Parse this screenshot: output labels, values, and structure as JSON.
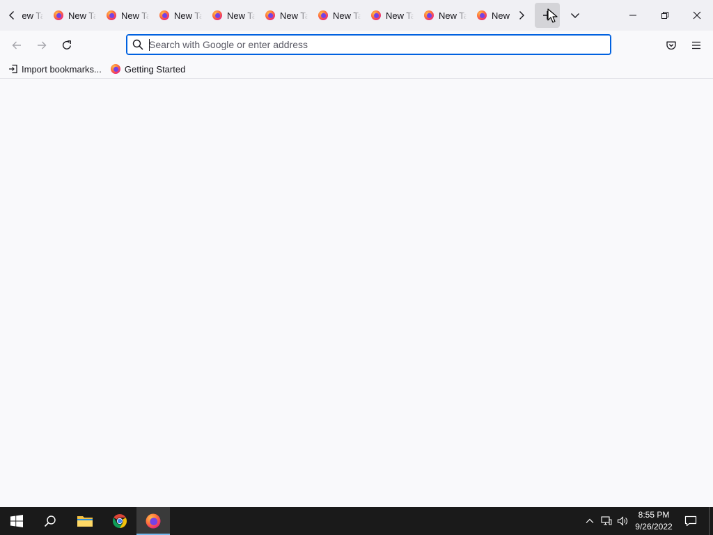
{
  "browser": {
    "tabs": [
      {
        "label": "New Tab"
      },
      {
        "label": "New Tab"
      },
      {
        "label": "New Tab"
      },
      {
        "label": "New Tab"
      },
      {
        "label": "New Tab"
      },
      {
        "label": "New Tab"
      },
      {
        "label": "New Tab"
      },
      {
        "label": "New Tab"
      },
      {
        "label": "New Tab"
      },
      {
        "label": "New Tab"
      }
    ],
    "tab_icon": "firefox-icon",
    "newtab_icon": "plus-icon",
    "alltabs_icon": "chevron-down-icon"
  },
  "navbar": {
    "back_icon": "arrow-left-icon",
    "forward_icon": "arrow-right-icon",
    "reload_icon": "reload-icon",
    "url_value": "",
    "url_placeholder": "Search with Google or enter address",
    "pocket_icon": "pocket-icon",
    "menu_icon": "hamburger-menu-icon"
  },
  "bookmarks": {
    "items": [
      {
        "label": "Import bookmarks...",
        "icon": "import-icon"
      },
      {
        "label": "Getting Started",
        "icon": "firefox-icon"
      }
    ]
  },
  "taskbar": {
    "apps": [
      "start-icon",
      "search-icon",
      "file-explorer-icon",
      "chrome-icon",
      "firefox-icon"
    ],
    "time": "8:55 PM",
    "date": "9/26/2022"
  },
  "colors": {
    "accent": "#0061e0",
    "tabstrip_bg": "#f0f0f4",
    "content_bg": "#f9f9fb",
    "taskbar_bg": "#1a1a1a"
  }
}
